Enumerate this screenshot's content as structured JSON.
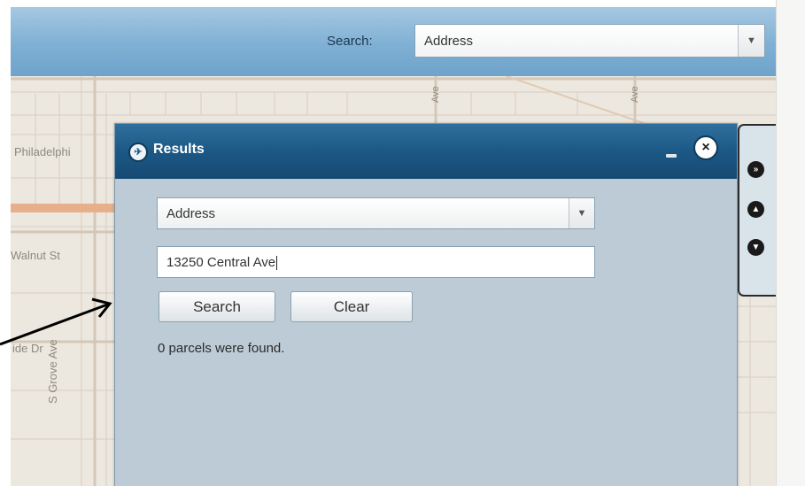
{
  "header": {
    "search_label": "Search:",
    "search_type": "Address"
  },
  "map": {
    "labels": {
      "philadelphia": "Philadelphi",
      "walnut": "Walnut St",
      "side_dr": "ide Dr",
      "grove": "S Grove Ave",
      "ave_a": "Ave",
      "ave_b": "Ave"
    }
  },
  "results": {
    "title": "Results",
    "search_type": "Address",
    "address_value": "13250 Central Ave",
    "search_button": "Search",
    "clear_button": "Clear",
    "status": "0 parcels were found."
  },
  "icons": {
    "minimize": "minimize-icon",
    "close": "close-icon",
    "dropdown": "chevron-down-icon",
    "side_tab_next": "next-icon",
    "side_tab_up": "up-icon",
    "side_tab_down": "down-icon"
  },
  "colors": {
    "header_bar": "#7fb0d4",
    "panel_header": "#1c5885",
    "panel_body": "#bccbd5",
    "map_road": "#e8b08a"
  }
}
